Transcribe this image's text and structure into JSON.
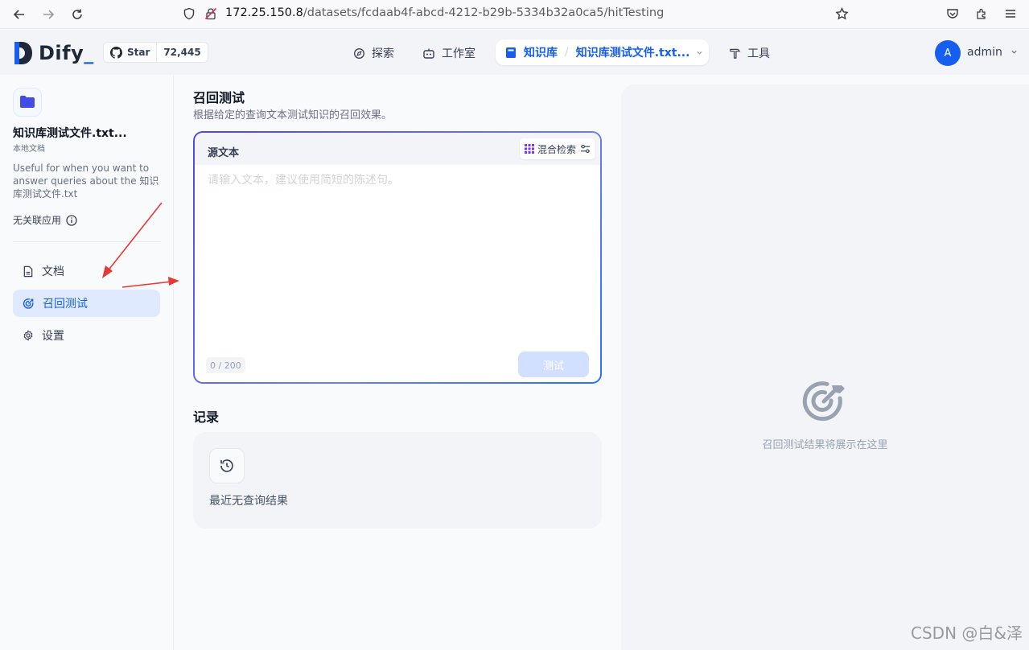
{
  "browser": {
    "url_host": "172.25.150.8",
    "url_path": "/datasets/fcdaab4f-abcd-4212-b29b-5334b32a0ca5/hitTesting"
  },
  "header": {
    "logo_text": "Dify",
    "logo_suffix": "_",
    "github_star_label": "Star",
    "github_star_count": "72,445",
    "nav": {
      "explore": "探索",
      "studio": "工作室",
      "knowledge": "知识库",
      "current_dataset": "知识库测试文件.txt...",
      "tools": "工具"
    },
    "user_initial": "A",
    "user_name": "admin"
  },
  "sidebar": {
    "dataset_name": "知识库测试文件.txt...",
    "dataset_type": "本地文档",
    "description": "Useful for when you want to answer queries about the 知识库测试文件.txt",
    "no_related_app": "无关联应用",
    "items": [
      {
        "label": "文档",
        "icon": "document-icon",
        "active": false
      },
      {
        "label": "召回测试",
        "icon": "target-icon",
        "active": true
      },
      {
        "label": "设置",
        "icon": "gear-icon",
        "active": false
      }
    ]
  },
  "main": {
    "title": "召回测试",
    "subtitle": "根据给定的查询文本测试知识的召回效果。",
    "query": {
      "label": "源文本",
      "retrieval_mode": "混合检索",
      "placeholder": "请输入文本，建议使用简短的陈述句。",
      "value": "",
      "char_count": "0",
      "char_limit": "/ 200",
      "test_button": "测试"
    },
    "records": {
      "title": "记录",
      "empty_text": "最近无查询结果"
    }
  },
  "result_panel": {
    "empty_text": "召回测试结果将展示在这里"
  },
  "watermark": "CSDN @白&泽",
  "colors": {
    "accent": "#155eef",
    "active_bg": "#e0eaff",
    "annotation_arrow": "#e53935"
  }
}
